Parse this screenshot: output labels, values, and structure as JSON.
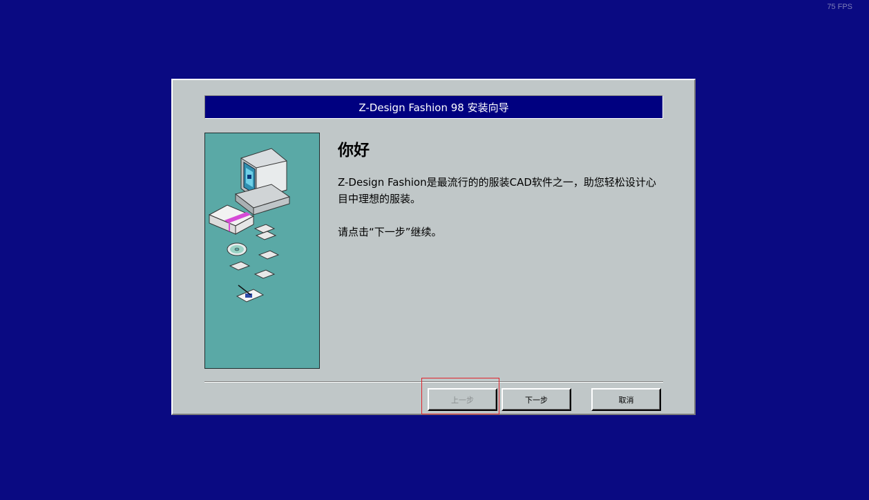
{
  "fps_counter": "75 FPS",
  "dialog": {
    "title": "Z-Design Fashion 98 安装向导",
    "heading": "你好",
    "paragraph1": "Z-Design Fashion是最流行的的服装CAD软件之一，助您轻松设计心目中理想的服装。",
    "paragraph2": "请点击“下一步”继续。",
    "buttons": {
      "back_label": "上一步",
      "next_label": "下一步",
      "cancel_label": "取消"
    }
  },
  "icons": {
    "illustration": "computer-setup-illustration",
    "monitor": "monitor-icon",
    "cd": "cd-icon",
    "floppy": "floppy-disk-icon",
    "document": "document-pen-icon"
  },
  "colors": {
    "desktop": "#0a0a82",
    "title_bar": "#000080",
    "dialog_face": "#c0c7c8",
    "illustration_bg": "#5aa9a6",
    "highlight": "#e0222a"
  }
}
